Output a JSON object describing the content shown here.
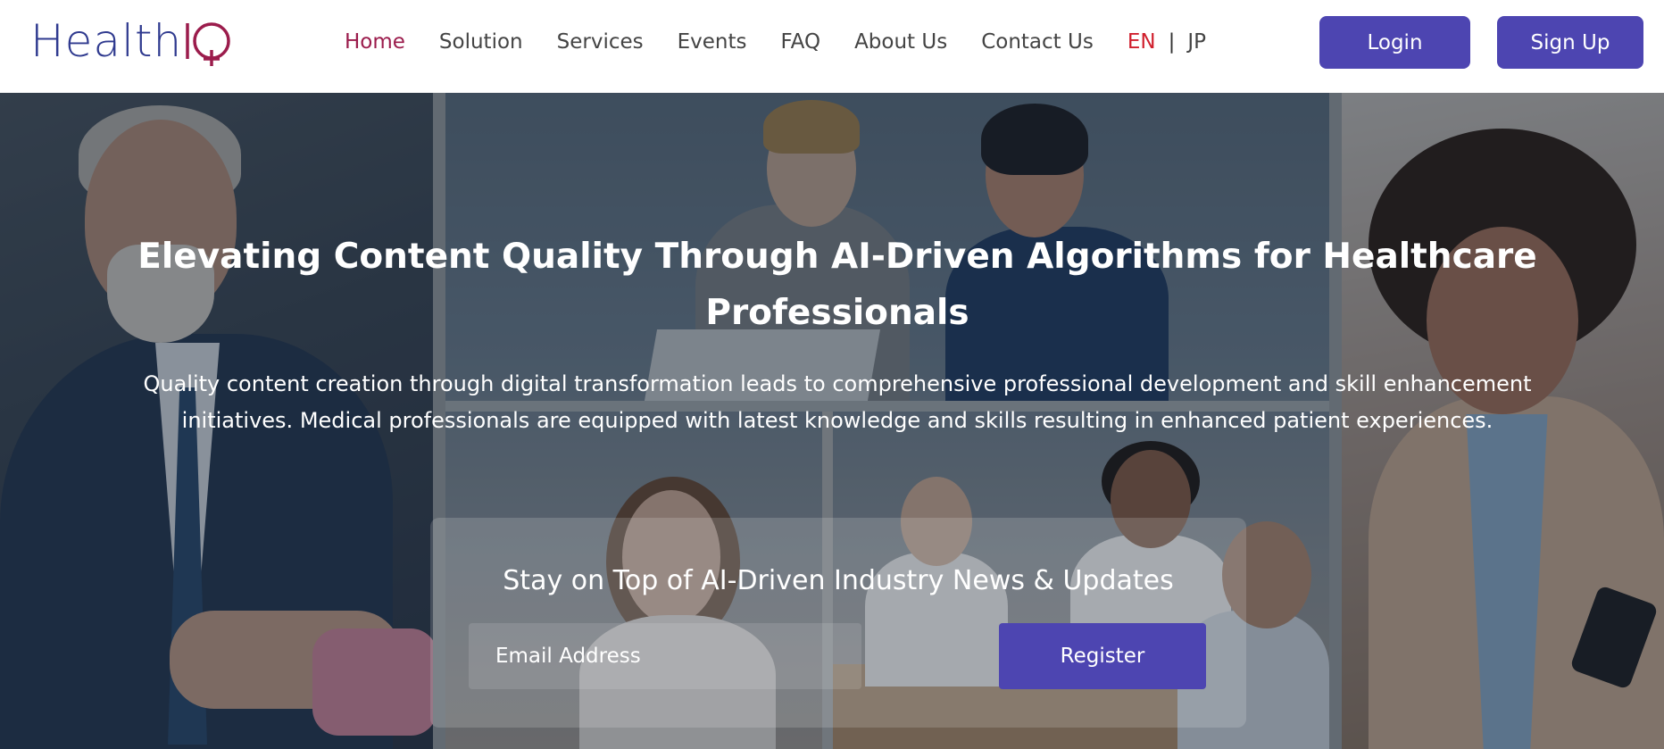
{
  "brand": {
    "logo_text": "Health",
    "logo_mark": "IQ",
    "logo_color": "#2f3a8f",
    "accent_color": "#9b1c4c"
  },
  "nav": {
    "items": [
      {
        "label": "Home",
        "active": true
      },
      {
        "label": "Solution",
        "active": false
      },
      {
        "label": "Services",
        "active": false
      },
      {
        "label": "Events",
        "active": false
      },
      {
        "label": "FAQ",
        "active": false
      },
      {
        "label": "About Us",
        "active": false
      },
      {
        "label": "Contact Us",
        "active": false
      }
    ],
    "lang": {
      "en": "EN",
      "separator": "|",
      "jp": "JP",
      "selected": "EN"
    }
  },
  "auth": {
    "login_label": "Login",
    "signup_label": "Sign Up",
    "button_color": "#4d45b1"
  },
  "hero": {
    "title": "Elevating Content Quality Through AI-Driven Algorithms for Healthcare Professionals",
    "description": "Quality content creation through digital transformation leads to comprehensive professional development and skill enhancement initiatives. Medical professionals are equipped with latest knowledge and skills resulting in enhanced patient experiences."
  },
  "newsletter": {
    "title": "Stay on Top of AI-Driven Industry News & Updates",
    "email_placeholder": "Email Address",
    "email_value": "",
    "register_label": "Register"
  },
  "icons": {
    "logo": "health-iq-logo-icon"
  }
}
